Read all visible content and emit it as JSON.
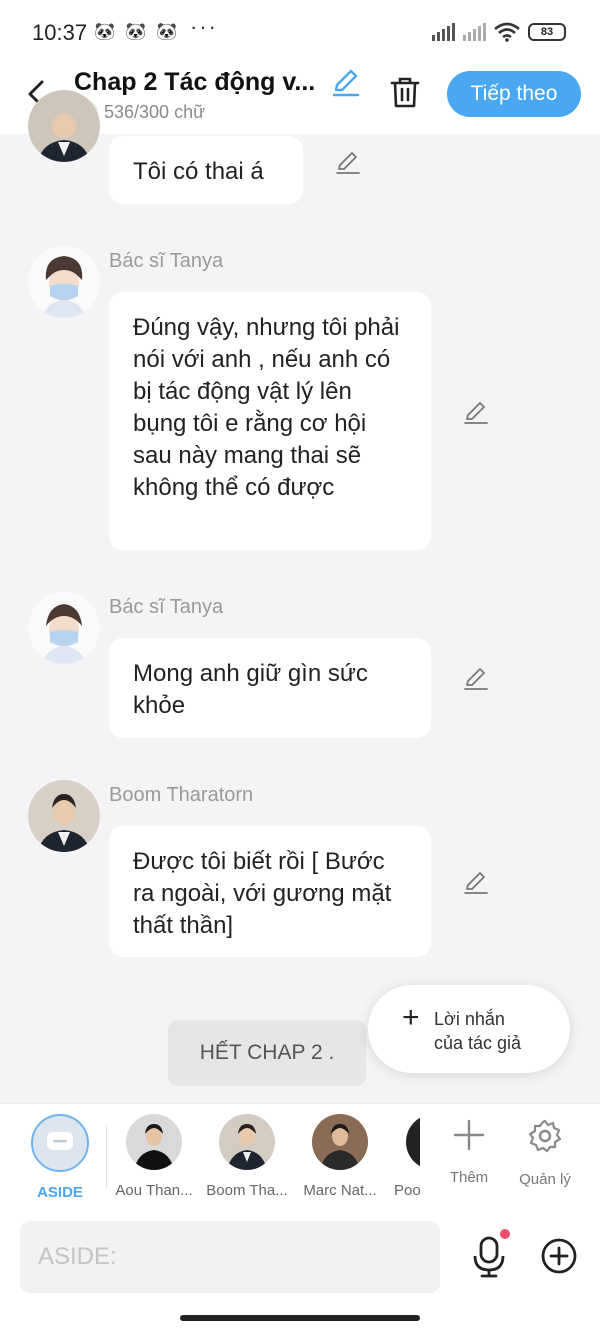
{
  "status": {
    "time": "10:37",
    "notification_icons": [
      "panda-icon",
      "panda-icon",
      "panda-icon"
    ],
    "more": "···",
    "battery": "83"
  },
  "header": {
    "title": "Chap 2 Tác động v...",
    "word_count": "536/300 chữ",
    "next_label": "Tiếp theo"
  },
  "messages": [
    {
      "speaker": "",
      "text": "Tôi có thai á"
    },
    {
      "speaker": "Bác sĩ Tanya",
      "text": "Đúng vậy, nhưng tôi phải nói với anh , nếu anh có bị tác động vật lý lên bụng tôi e rằng cơ hội sau này mang thai sẽ không thể có được"
    },
    {
      "speaker": "Bác sĩ Tanya",
      "text": "Mong anh giữ gìn sức khỏe"
    },
    {
      "speaker": "Boom Tharatorn",
      "text": "Được tôi biết rồi [ Bước ra ngoài, với gương mặt thất thần]"
    }
  ],
  "end_marker": "HẾT CHAP 2 .",
  "author_note": {
    "line1": "Lời nhắn",
    "line2": "của tác giả"
  },
  "characters": [
    {
      "label": "ASIDE"
    },
    {
      "label": "Aou Than..."
    },
    {
      "label": "Boom Tha..."
    },
    {
      "label": "Marc Nat..."
    },
    {
      "label": "Poo"
    }
  ],
  "tools": {
    "add_label": "Thêm",
    "manage_label": "Quản lý"
  },
  "input": {
    "placeholder": "ASIDE:"
  },
  "colors": {
    "accent": "#4aa7f1",
    "success": "#3cb25c",
    "notification_dot": "#f0506e"
  }
}
